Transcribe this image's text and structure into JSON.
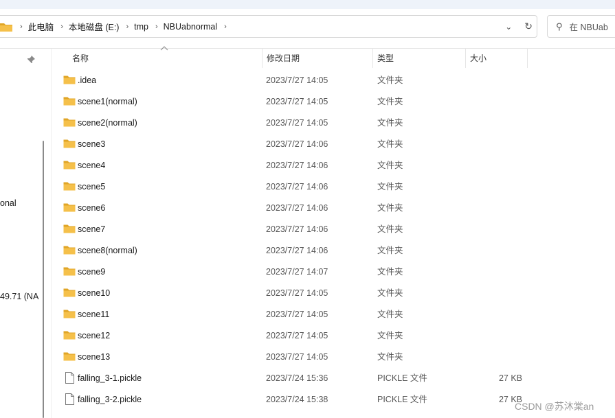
{
  "breadcrumb": [
    "此电脑",
    "本地磁盘 (E:)",
    "tmp",
    "NBUabnormal"
  ],
  "address_controls": {
    "dropdown_icon": "chevron-down-icon",
    "refresh_icon": "refresh-icon"
  },
  "search": {
    "text": "在 NBUab",
    "icon": "search-icon"
  },
  "nav": {
    "text1": "onal",
    "text2": "49.71 (NA",
    "pin_icon": "pin-icon"
  },
  "columns": {
    "name": "名称",
    "date": "修改日期",
    "type": "类型",
    "size": "大小"
  },
  "colors": {
    "folder": "#f5c04a",
    "folder_dark": "#e0a526",
    "accent": "#0078d4"
  },
  "files": [
    {
      "name": ".idea",
      "date": "2023/7/27 14:05",
      "type": "文件夹",
      "size": "",
      "kind": "folder"
    },
    {
      "name": "scene1(normal)",
      "date": "2023/7/27 14:05",
      "type": "文件夹",
      "size": "",
      "kind": "folder"
    },
    {
      "name": "scene2(normal)",
      "date": "2023/7/27 14:05",
      "type": "文件夹",
      "size": "",
      "kind": "folder"
    },
    {
      "name": "scene3",
      "date": "2023/7/27 14:06",
      "type": "文件夹",
      "size": "",
      "kind": "folder"
    },
    {
      "name": "scene4",
      "date": "2023/7/27 14:06",
      "type": "文件夹",
      "size": "",
      "kind": "folder"
    },
    {
      "name": "scene5",
      "date": "2023/7/27 14:06",
      "type": "文件夹",
      "size": "",
      "kind": "folder"
    },
    {
      "name": "scene6",
      "date": "2023/7/27 14:06",
      "type": "文件夹",
      "size": "",
      "kind": "folder"
    },
    {
      "name": "scene7",
      "date": "2023/7/27 14:06",
      "type": "文件夹",
      "size": "",
      "kind": "folder"
    },
    {
      "name": "scene8(normal)",
      "date": "2023/7/27 14:06",
      "type": "文件夹",
      "size": "",
      "kind": "folder"
    },
    {
      "name": "scene9",
      "date": "2023/7/27 14:07",
      "type": "文件夹",
      "size": "",
      "kind": "folder"
    },
    {
      "name": "scene10",
      "date": "2023/7/27 14:05",
      "type": "文件夹",
      "size": "",
      "kind": "folder"
    },
    {
      "name": "scene11",
      "date": "2023/7/27 14:05",
      "type": "文件夹",
      "size": "",
      "kind": "folder"
    },
    {
      "name": "scene12",
      "date": "2023/7/27 14:05",
      "type": "文件夹",
      "size": "",
      "kind": "folder"
    },
    {
      "name": "scene13",
      "date": "2023/7/27 14:05",
      "type": "文件夹",
      "size": "",
      "kind": "folder"
    },
    {
      "name": "falling_3-1.pickle",
      "date": "2023/7/24 15:36",
      "type": "PICKLE 文件",
      "size": "27 KB",
      "kind": "file"
    },
    {
      "name": "falling_3-2.pickle",
      "date": "2023/7/24 15:38",
      "type": "PICKLE 文件",
      "size": "27 KB",
      "kind": "file"
    }
  ],
  "watermark": "CSDN @苏沐棠an"
}
